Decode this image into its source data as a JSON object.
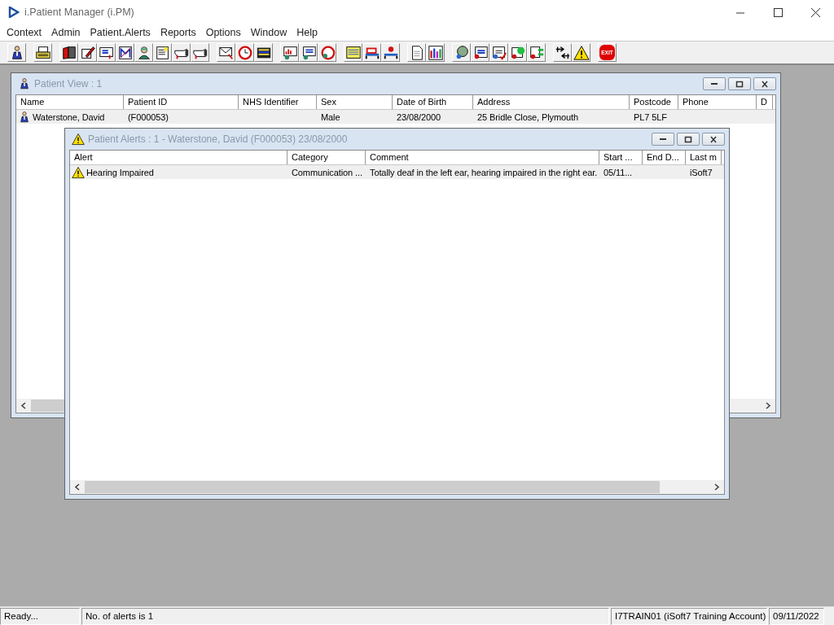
{
  "app": {
    "title": "i.Patient Manager (i.PM)"
  },
  "menu": [
    "Context",
    "Admin",
    "Patient.Alerts",
    "Reports",
    "Options",
    "Window",
    "Help"
  ],
  "toolbar": {
    "exit_label": "EXIT"
  },
  "patient_view": {
    "title": "Patient View : 1",
    "columns": [
      "Name",
      "Patient ID",
      "NHS Identifier",
      "Sex",
      "Date of Birth",
      "Address",
      "Postcode",
      "Phone",
      "D"
    ],
    "rows": [
      {
        "selected": true,
        "cells": [
          "Waterstone, David",
          "(F000053)",
          "",
          "Male",
          "23/08/2000",
          "25 Bridle Close, Plymouth",
          "PL7 5LF",
          "",
          ""
        ]
      }
    ]
  },
  "alerts_window": {
    "title": "Patient Alerts : 1 - Waterstone, David (F000053) 23/08/2000",
    "columns": [
      "Alert",
      "Category",
      "Comment",
      "Start ...",
      "End D...",
      "Last m"
    ],
    "rows": [
      {
        "selected": true,
        "cells": [
          "Hearing Impaired",
          "Communication ...",
          "Totally deaf in the left ear, hearing impaired in the right ear.",
          "05/11...",
          "",
          "iSoft7"
        ]
      }
    ]
  },
  "status_bar": [
    "Ready...",
    "No. of alerts is 1",
    "I7TRAIN01 (iSoft7 Training Account)",
    "09/11/2022"
  ]
}
